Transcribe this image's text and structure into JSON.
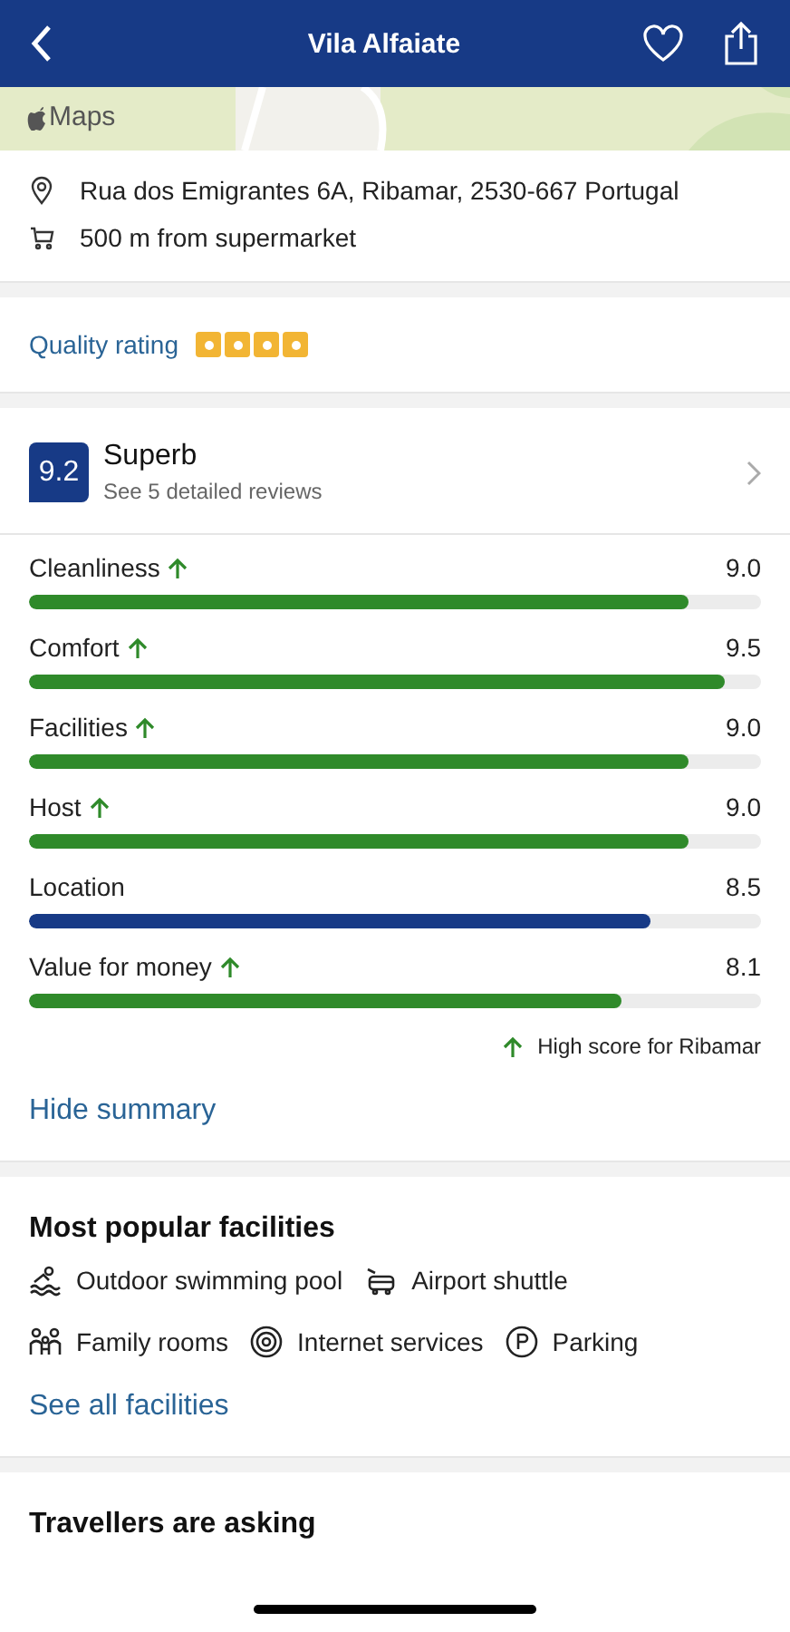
{
  "header": {
    "title": "Vila Alfaiate"
  },
  "map": {
    "label": "Maps"
  },
  "location": [
    {
      "kind": "address",
      "text": "Rua dos Emigrantes 6A, Ribamar, 2530-667 Portugal"
    },
    {
      "kind": "shop",
      "text": "500 m from supermarket"
    }
  ],
  "quality": {
    "label": "Quality rating",
    "squares": [
      {
        "filled": true
      },
      {
        "filled": true
      },
      {
        "filled": true
      },
      {
        "filled": true
      }
    ]
  },
  "score": {
    "value": "9.2",
    "verdict": "Superb",
    "reviews": "See 5 detailed reviews"
  },
  "categories": [
    {
      "name": "Cleanliness",
      "score": "9.0",
      "level": 0.9,
      "high": true
    },
    {
      "name": "Comfort",
      "score": "9.5",
      "level": 0.95,
      "high": true
    },
    {
      "name": "Facilities",
      "score": "9.0",
      "level": 0.9,
      "high": true
    },
    {
      "name": "Host",
      "score": "9.0",
      "level": 0.9,
      "high": true
    },
    {
      "name": "Location",
      "score": "8.5",
      "level": 0.85,
      "high": false
    },
    {
      "name": "Value for money",
      "score": "8.1",
      "level": 0.81,
      "high": true
    }
  ],
  "high_note": "High score for Ribamar",
  "hide_link": "Hide summary",
  "facilities": {
    "title": "Most popular facilities",
    "items": [
      {
        "kind": "pool",
        "label": "Outdoor swimming pool"
      },
      {
        "kind": "shuttle",
        "label": "Airport shuttle"
      },
      {
        "kind": "family",
        "label": "Family rooms"
      },
      {
        "kind": "internet",
        "label": "Internet services"
      },
      {
        "kind": "parking",
        "label": "Parking"
      }
    ],
    "link": "See all facilities"
  },
  "next_section": {
    "title": "Travellers are asking"
  }
}
